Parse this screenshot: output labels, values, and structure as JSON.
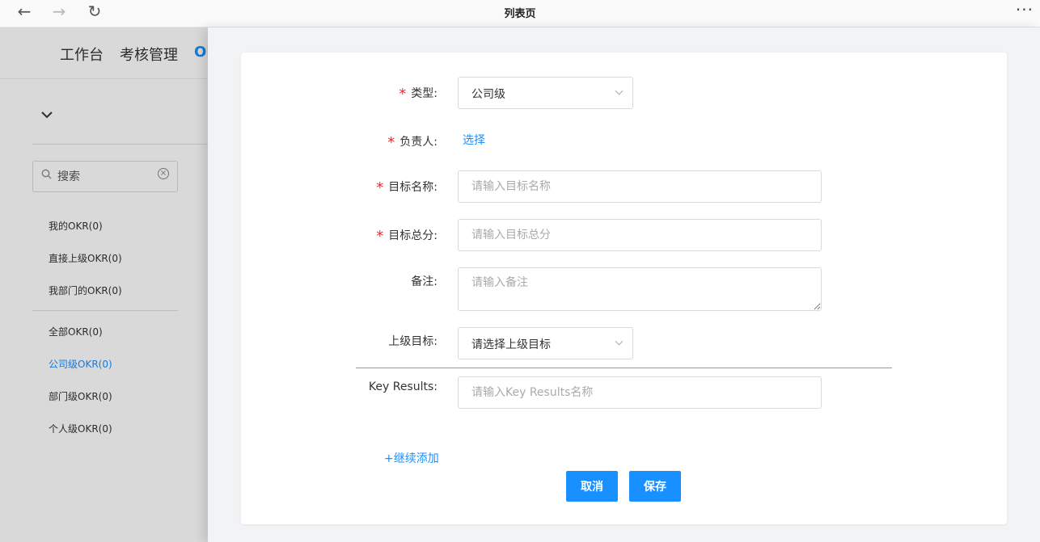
{
  "browser": {
    "back": "←",
    "forward": "→",
    "reload": "↻",
    "title": "列表页",
    "more": "···"
  },
  "left_page": {
    "top_nav": [
      {
        "label": "工作台"
      },
      {
        "label": "考核管理"
      },
      {
        "label": "OKR"
      }
    ],
    "search": {
      "placeholder": "搜索"
    },
    "menu_group1": [
      {
        "label": "我的OKR(0)"
      },
      {
        "label": "直接上级OKR(0)"
      },
      {
        "label": "我部门的OKR(0)"
      }
    ],
    "menu_group2": [
      {
        "label": "全部OKR(0)"
      },
      {
        "label": "公司级OKR(0)"
      },
      {
        "label": "部门级OKR(0)"
      },
      {
        "label": "个人级OKR(0)"
      }
    ],
    "active_color": "#1890ff"
  },
  "form": {
    "type": {
      "label": "类型:",
      "value": "公司级"
    },
    "owner": {
      "label": "负责人:",
      "action": "选择"
    },
    "goal_name": {
      "label": "目标名称:",
      "placeholder": "请输入目标名称"
    },
    "goal_score": {
      "label": "目标总分:",
      "placeholder": "请输入目标总分"
    },
    "remark": {
      "label": "备注:",
      "placeholder": "请输入备注"
    },
    "parent_goal": {
      "label": "上级目标:",
      "value": "请选择上级目标"
    },
    "key_results": {
      "label": "Key Results:",
      "placeholder": "请输入Key Results名称"
    },
    "add_more": "+继续添加",
    "cancel": "取消",
    "save": "保存",
    "required_mark": "*"
  }
}
